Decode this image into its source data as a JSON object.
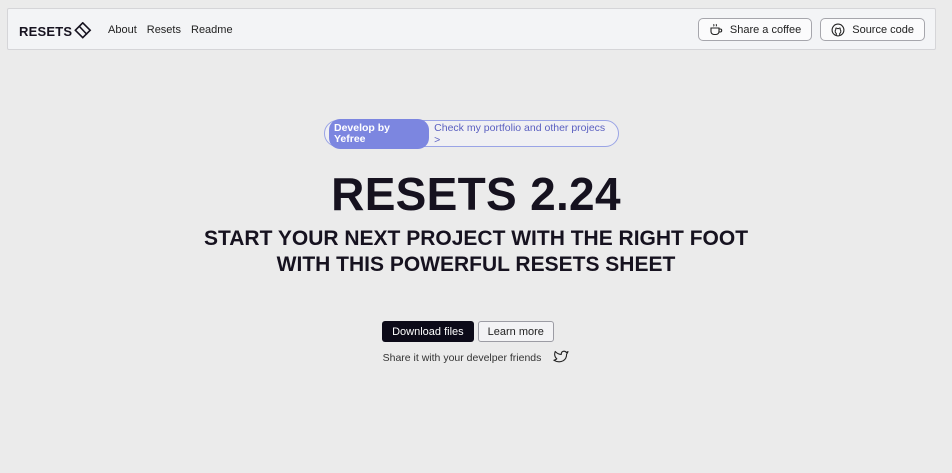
{
  "nav": {
    "brand": "RESETS",
    "links": [
      "About",
      "Resets",
      "Readme"
    ],
    "coffee_label": "Share a coffee",
    "source_label": "Source code"
  },
  "hero": {
    "badge": "Develop by Yefree",
    "badge_link": "Check my portfolio and other projecs >",
    "title": "RESETS 2.24",
    "subtitle": "START YOUR NEXT PROJECT WITH THE RIGHT FOOT WITH THIS POWERFUL RESETS SHEET",
    "download_label": "Download files",
    "learn_label": "Learn more",
    "share_text": "Share it with your develper friends"
  },
  "icons": {
    "brand": "diamond-logo-icon",
    "coffee": "coffee-cup-icon",
    "source": "github-icon",
    "share": "twitter-icon"
  },
  "colors": {
    "background": "#ebebeb",
    "accent": "#7c86e0",
    "primary_button": "#0c0a18",
    "text": "#16121f"
  }
}
